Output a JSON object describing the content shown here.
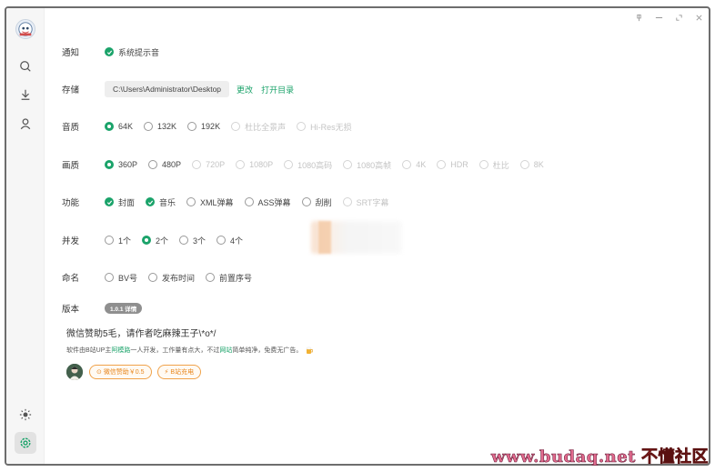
{
  "window": {
    "controls": [
      "pin-icon",
      "minimize-icon",
      "restore-icon",
      "close-icon"
    ]
  },
  "sidebar": {
    "items": [
      {
        "name": "app-logo",
        "icon": "app-logo-icon"
      },
      {
        "name": "search",
        "icon": "search-icon"
      },
      {
        "name": "download",
        "icon": "download-icon"
      },
      {
        "name": "user",
        "icon": "user-icon"
      },
      {
        "name": "theme",
        "icon": "sun-icon"
      },
      {
        "name": "settings",
        "icon": "settings-icon",
        "active": true
      }
    ]
  },
  "settings": {
    "notify": {
      "label": "通知",
      "option": "系统提示音",
      "checked": true
    },
    "storage": {
      "label": "存储",
      "path": "C:\\Users\\Administrator\\Desktop",
      "change": "更改",
      "open": "打开目录"
    },
    "audio": {
      "label": "音质",
      "options": [
        {
          "text": "64K",
          "selected": true,
          "disabled": false
        },
        {
          "text": "132K",
          "selected": false,
          "disabled": false
        },
        {
          "text": "192K",
          "selected": false,
          "disabled": false
        },
        {
          "text": "杜比全景声",
          "selected": false,
          "disabled": true
        },
        {
          "text": "Hi-Res无损",
          "selected": false,
          "disabled": true
        }
      ]
    },
    "video": {
      "label": "画质",
      "options": [
        {
          "text": "360P",
          "selected": true,
          "disabled": false
        },
        {
          "text": "480P",
          "selected": false,
          "disabled": false
        },
        {
          "text": "720P",
          "selected": false,
          "disabled": true
        },
        {
          "text": "1080P",
          "selected": false,
          "disabled": true
        },
        {
          "text": "1080高码",
          "selected": false,
          "disabled": true
        },
        {
          "text": "1080高帧",
          "selected": false,
          "disabled": true
        },
        {
          "text": "4K",
          "selected": false,
          "disabled": true
        },
        {
          "text": "HDR",
          "selected": false,
          "disabled": true
        },
        {
          "text": "杜比",
          "selected": false,
          "disabled": true
        },
        {
          "text": "8K",
          "selected": false,
          "disabled": true
        }
      ]
    },
    "features": {
      "label": "功能",
      "options": [
        {
          "text": "封面",
          "checked": true,
          "disabled": false
        },
        {
          "text": "音乐",
          "checked": true,
          "disabled": false
        },
        {
          "text": "XML弹幕",
          "checked": false,
          "disabled": false
        },
        {
          "text": "ASS弹幕",
          "checked": false,
          "disabled": false
        },
        {
          "text": "刮削",
          "checked": false,
          "disabled": false
        },
        {
          "text": "SRT字幕",
          "checked": false,
          "disabled": true
        }
      ]
    },
    "concurrency": {
      "label": "并发",
      "options": [
        {
          "text": "1个",
          "selected": false
        },
        {
          "text": "2个",
          "selected": true
        },
        {
          "text": "3个",
          "selected": false
        },
        {
          "text": "4个",
          "selected": false
        }
      ]
    },
    "naming": {
      "label": "命名",
      "options": [
        {
          "text": "BV号",
          "selected": false
        },
        {
          "text": "发布时间",
          "selected": false
        },
        {
          "text": "前置序号",
          "selected": false
        }
      ]
    },
    "version": {
      "label": "版本",
      "badge": "1.0.1 详情"
    }
  },
  "donate": {
    "headline": "微信赞助5毛，请作者吃麻辣王子\\*o*/",
    "note_pre": "软件由B站UP主",
    "note_author": "阿模路",
    "note_mid": "一人开发，工作量有点大，不过",
    "note_site": "网站",
    "note_post": "简单纯净，免费无广告。",
    "wechat_button": "微信赞助￥0.5",
    "bili_button": "B站充电"
  },
  "watermark": {
    "url": "www.budaq.net",
    "cn": "不懂社区"
  },
  "colors": {
    "accent": "#1ba36a",
    "donate": "#e8871e",
    "watermark_url": "#e26b8e",
    "watermark_cn": "#f04848"
  }
}
